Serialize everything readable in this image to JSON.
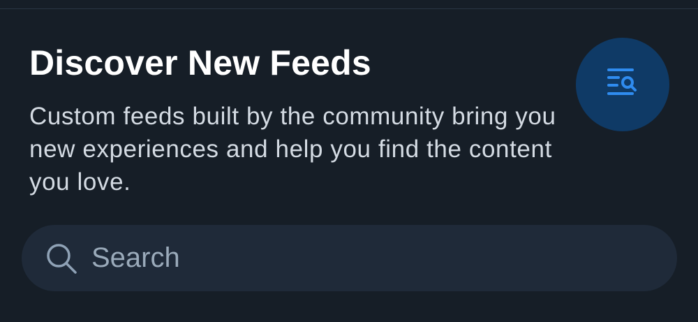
{
  "header": {
    "title": "Discover New Feeds",
    "description": "Custom feeds built by the community bring you new experiences and help you find the content you love."
  },
  "search": {
    "placeholder": "Search"
  },
  "icons": {
    "feed_icon": "feed-search-icon",
    "search_icon": "magnifying-glass-icon"
  },
  "colors": {
    "background": "#161e27",
    "accent": "#2f8cf0",
    "icon_circle": "#0f3a66",
    "search_bar": "#1f2a39"
  }
}
